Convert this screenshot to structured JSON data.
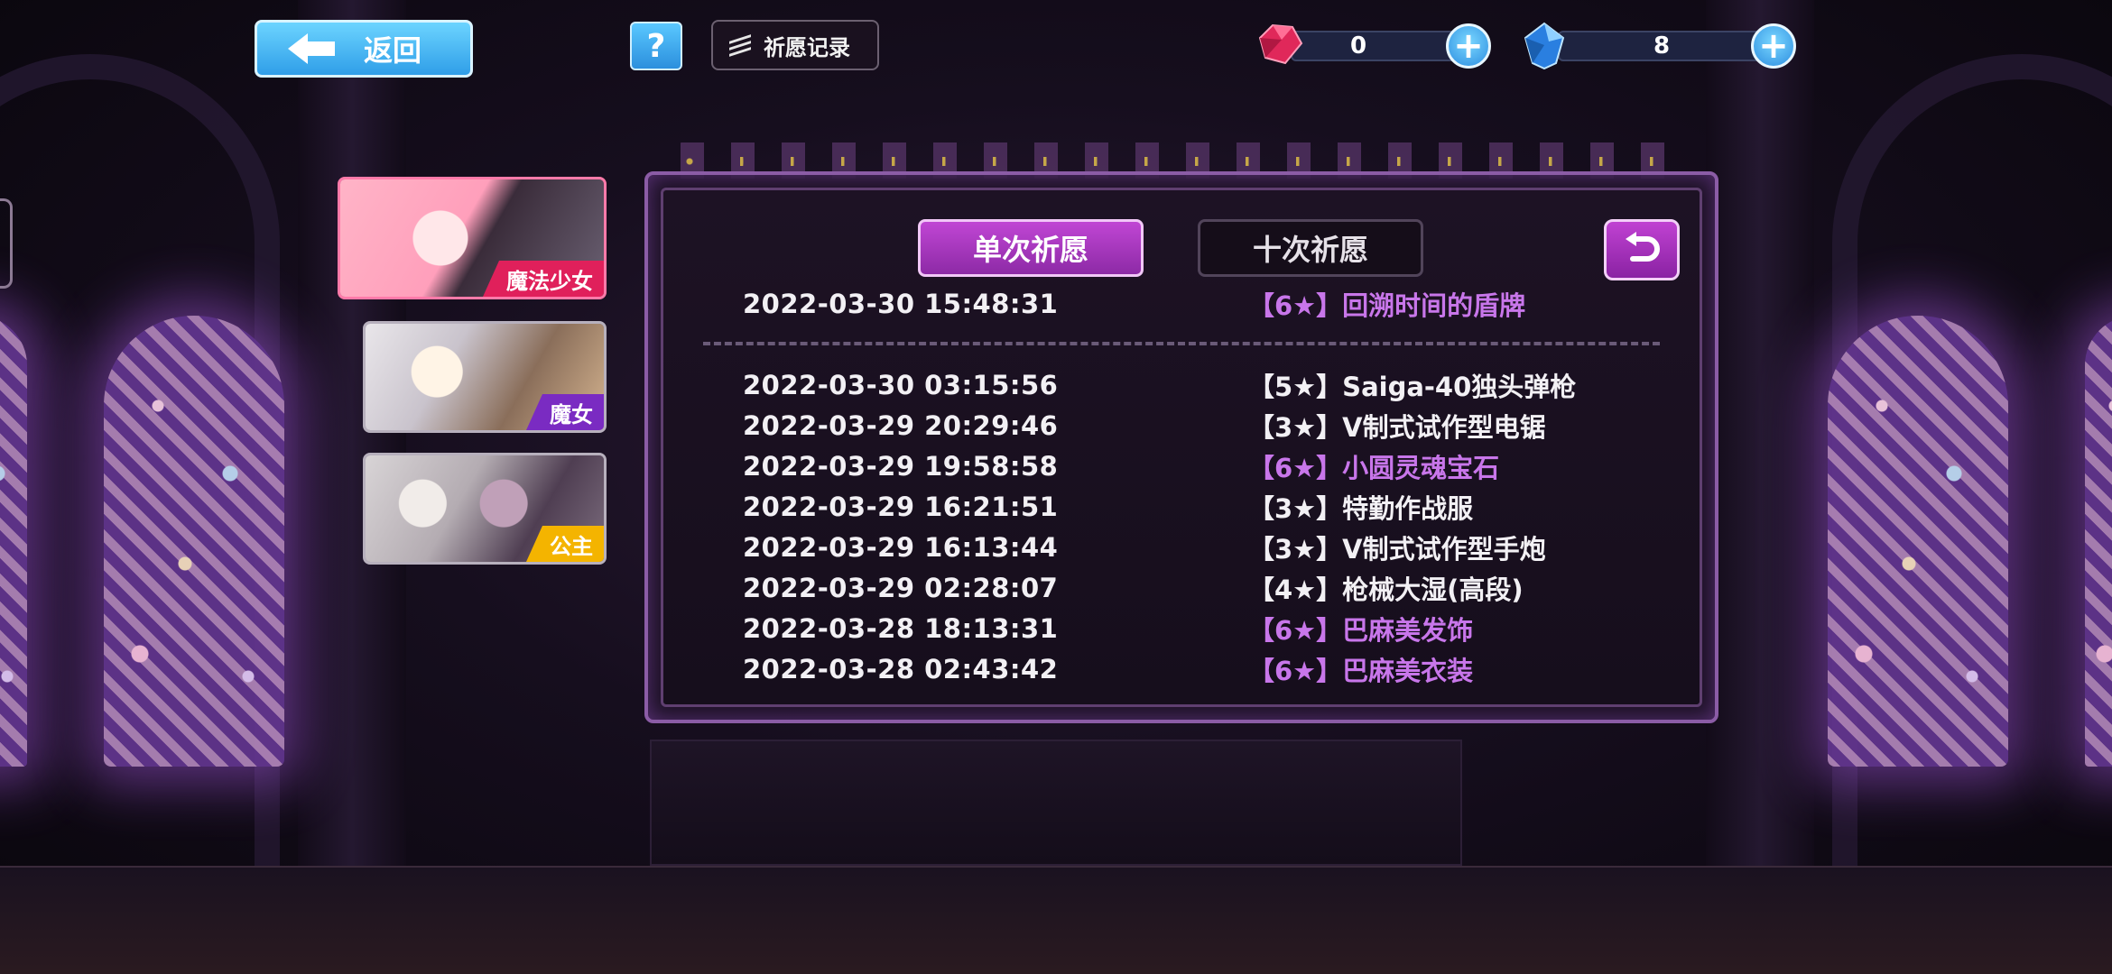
{
  "topbar": {
    "back_label": "返回",
    "help_label": "?",
    "record_label": "祈愿记录"
  },
  "currency": {
    "red_gem": {
      "icon": "red-gem-icon",
      "value": "0",
      "color": "#e0285a"
    },
    "blue_gem": {
      "icon": "blue-gem-icon",
      "value": "8",
      "color": "#3aa8ff"
    },
    "plus_label": "+"
  },
  "side_cards": [
    {
      "label": "魔法少女",
      "badge_color": "#e0205b"
    },
    {
      "label": "魔女",
      "badge_color": "#7a2bc2"
    },
    {
      "label": "公主",
      "badge_color": "#f4b400"
    }
  ],
  "tabs": {
    "single": "单次祈愿",
    "ten": "十次祈愿"
  },
  "records": [
    {
      "time": "2022-03-30 15:48:31",
      "item": "【6★】回溯时间的盾牌",
      "rarity": 6
    },
    {
      "time": "2022-03-30 03:15:56",
      "item": "【5★】Saiga-40独头弹枪",
      "rarity": 5
    },
    {
      "time": "2022-03-29 20:29:46",
      "item": "【3★】V制式试作型电锯",
      "rarity": 3
    },
    {
      "time": "2022-03-29 19:58:58",
      "item": "【6★】小圆灵魂宝石",
      "rarity": 6
    },
    {
      "time": "2022-03-29 16:21:51",
      "item": "【3★】特勤作战服",
      "rarity": 3
    },
    {
      "time": "2022-03-29 16:13:44",
      "item": "【3★】V制式试作型手炮",
      "rarity": 3
    },
    {
      "time": "2022-03-29 02:28:07",
      "item": "【4★】枪械大湿(高段)",
      "rarity": 4
    },
    {
      "time": "2022-03-28 18:13:31",
      "item": "【6★】巴麻美发饰",
      "rarity": 6
    },
    {
      "time": "2022-03-28 02:43:42",
      "item": "【6★】巴麻美衣装",
      "rarity": 6
    }
  ],
  "colors": {
    "six_star": "#c876ea",
    "normal": "#f2f0f4",
    "accent": "#b23cc8"
  }
}
